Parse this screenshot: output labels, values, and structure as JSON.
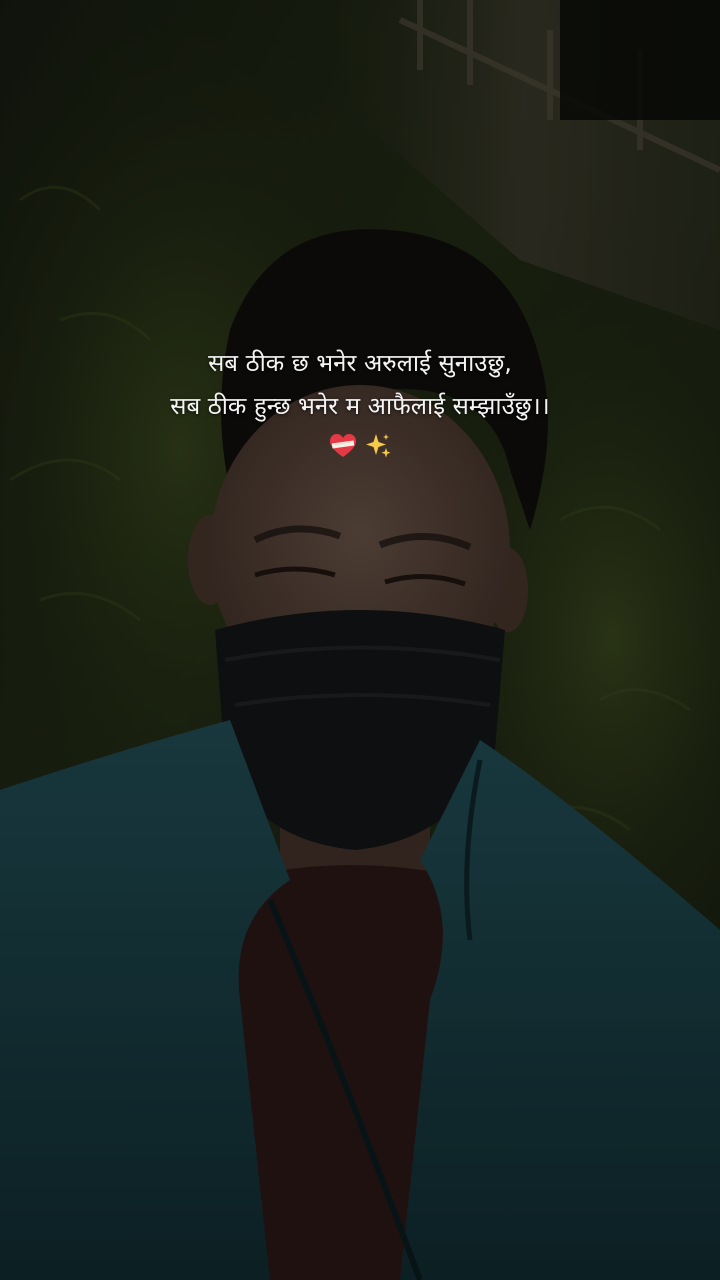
{
  "caption": {
    "line1": "सब ठीक छ भनेर अरुलाई सुनाउछु,",
    "line2": "सब ठीक हुन्छ भनेर म आफैलाई सम्झाउँछु।।",
    "emojis": [
      "mending-heart-icon",
      "sparkles-icon"
    ]
  },
  "colors": {
    "overlay": "#000000",
    "jacket": "#1f4a52",
    "foliage": "#3a4a22",
    "text": "#f4f4f4",
    "heart": "#e63946",
    "sparkle": "#f7c948"
  }
}
